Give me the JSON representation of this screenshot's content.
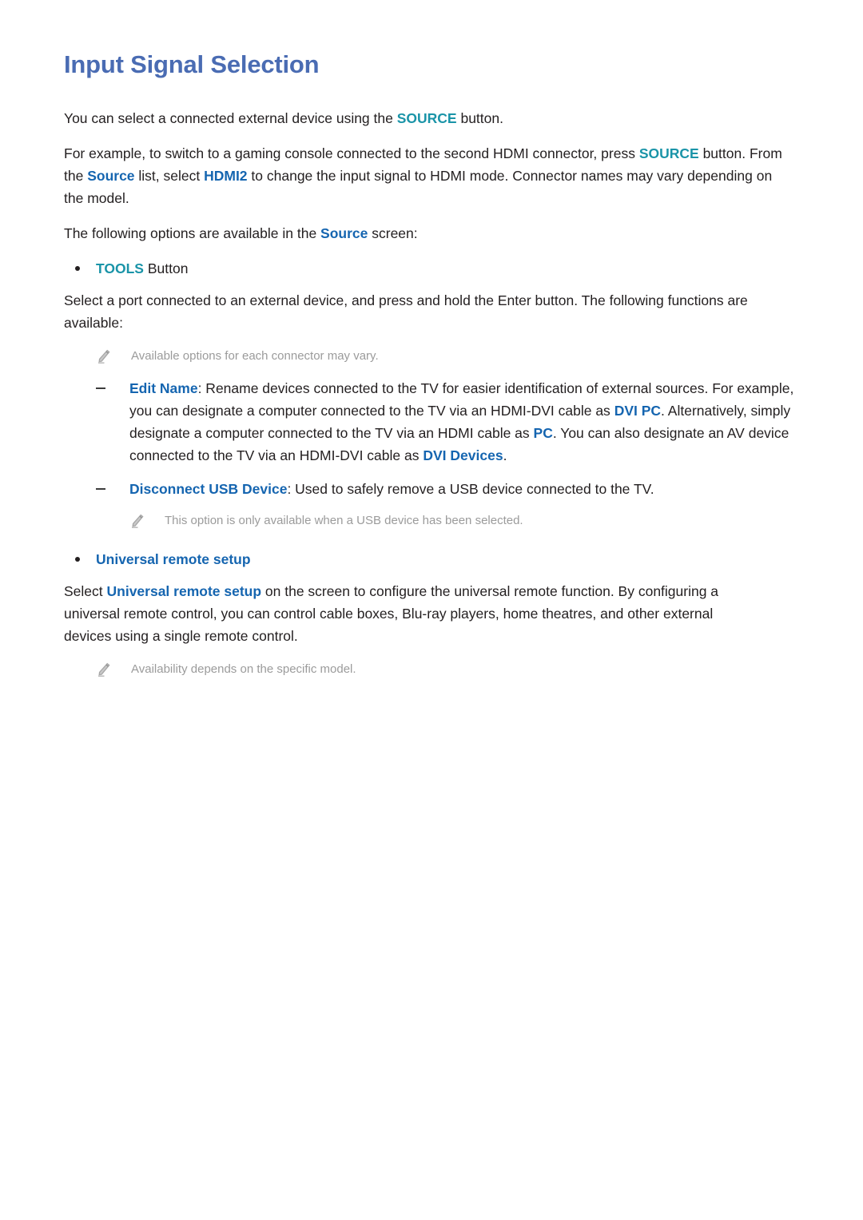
{
  "page": {
    "title": "Input Signal Selection",
    "title_color": "#4a6cb3",
    "body_color": "#231f20",
    "accent_teal": "#1a94a8",
    "accent_blue": "#1565b0",
    "note_color": "#9b9b9b"
  },
  "paragraphs": {
    "intro": {
      "part1": "You can select a connected external device using the ",
      "term_source_button": "SOURCE",
      "part2": " button."
    },
    "example": {
      "part1": "For example, to switch to a gaming console connected to the second HDMI connector, press ",
      "term_source_button": "SOURCE",
      "part2": " button. From the ",
      "term_source_list": "Source",
      "part3": " list, select ",
      "term_hdmi2": "HDMI2",
      "part4": " to change the input signal to HDMI mode. Connector names may vary depending on the model."
    },
    "options_intro": {
      "part1": "The following options are available in the ",
      "term_source": "Source",
      "part2": " screen:"
    }
  },
  "tools_section": {
    "bullet_label_term": "TOOLS",
    "bullet_label_rest": " Button",
    "description": "Select a port connected to an external device, and press and hold the Enter button. The following functions are available:",
    "note": "Available options for each connector may vary.",
    "items": [
      {
        "term": "Edit Name",
        "text_part1": ": Rename devices connected to the TV for easier identification of external sources. For example, you can designate a computer connected to the TV via an HDMI-DVI cable as ",
        "term2": "DVI PC",
        "text_part2": ". Alternatively, simply designate a computer connected to the TV via an HDMI cable as ",
        "term3": "PC",
        "text_part3": ". You can also designate an AV device connected to the TV via an HDMI-DVI cable as ",
        "term4": "DVI Devices",
        "text_part4": "."
      },
      {
        "term": "Disconnect USB Device",
        "text_part1": ": Used to safely remove a USB device connected to the TV.",
        "note": "This option is only available when a USB device has been selected."
      }
    ]
  },
  "universal_remote_section": {
    "bullet_label": "Universal remote setup",
    "description_part1": "Select ",
    "description_term": "Universal remote setup",
    "description_part2": " on the screen to configure the universal remote function. By configuring a universal remote control, you can control cable boxes, Blu-ray players, home theatres, and other external devices using a single remote control.",
    "note": "Availability depends on the specific model."
  },
  "icons": {
    "pencil": "pencil-icon",
    "bullet": "bullet-dot",
    "dash": "dash-marker"
  }
}
